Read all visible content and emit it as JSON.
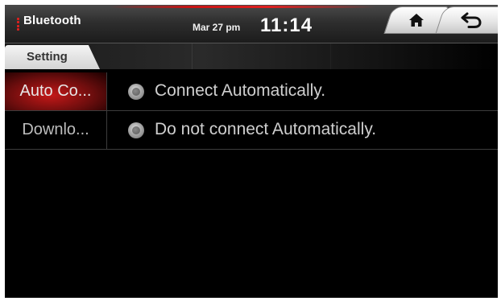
{
  "status_bar": {
    "app_title": "Bluetooth",
    "date": "Mar 27 pm",
    "time": "11:14",
    "accent_color": "#e0201e"
  },
  "nav": {
    "home_icon": "home-icon",
    "back_icon": "back-arrow-icon"
  },
  "tabs": [
    {
      "label": "Setting",
      "active": true
    }
  ],
  "settings": {
    "rows": [
      {
        "label": "Auto Co...",
        "option_text": "Connect Automatically.",
        "highlighted": true
      },
      {
        "label": "Downlo...",
        "option_text": "Do not connect Automatically.",
        "highlighted": false
      }
    ]
  }
}
